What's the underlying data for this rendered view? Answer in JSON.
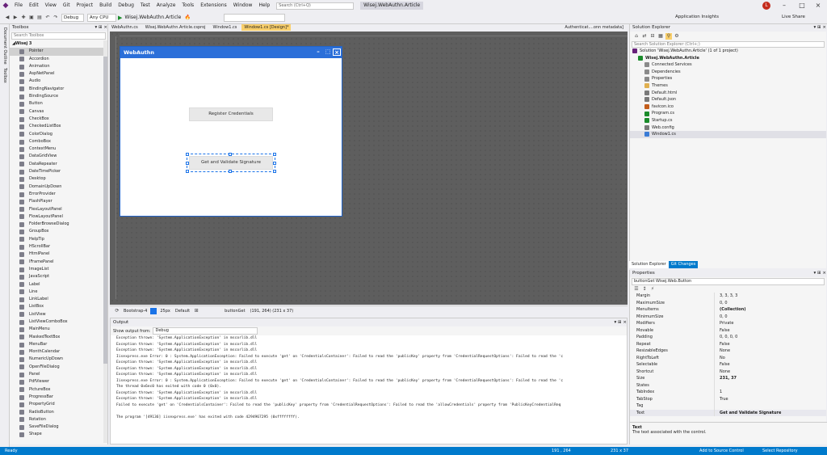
{
  "app": {
    "solution_name": "Wisej.WebAuthn.Article",
    "search_placeholder": "Search (Ctrl+Q)",
    "avatar": "L",
    "live_share": "Live Share",
    "app_insights": "Application Insights"
  },
  "menu": [
    "File",
    "Edit",
    "View",
    "Git",
    "Project",
    "Build",
    "Debug",
    "Test",
    "Analyze",
    "Tools",
    "Extensions",
    "Window",
    "Help"
  ],
  "toolbar": {
    "config": "Debug",
    "platform": "Any CPU",
    "start_target": "Wisej.WebAuthn.Article"
  },
  "left_strip": [
    "Document Outline",
    "Toolbox"
  ],
  "toolbox": {
    "title": "Toolbox",
    "search_placeholder": "Search Toolbox",
    "group": "Wisej 3",
    "items": [
      "Pointer",
      "Accordion",
      "Animation",
      "AspNetPanel",
      "Audio",
      "BindingNavigator",
      "BindingSource",
      "Button",
      "Canvas",
      "CheckBox",
      "CheckedListBox",
      "ColorDialog",
      "ComboBox",
      "ContextMenu",
      "DataGridView",
      "DataRepeater",
      "DateTimePicker",
      "Desktop",
      "DomainUpDown",
      "ErrorProvider",
      "FlashPlayer",
      "FlexLayoutPanel",
      "FlowLayoutPanel",
      "FolderBrowseDialog",
      "GroupBox",
      "HelpTip",
      "HScrollBar",
      "HtmlPanel",
      "IFramePanel",
      "ImageList",
      "JavaScript",
      "Label",
      "Line",
      "LinkLabel",
      "ListBox",
      "ListView",
      "ListViewComboBox",
      "MainMenu",
      "MaskedTextBox",
      "MenuBar",
      "MonthCalendar",
      "NumericUpDown",
      "OpenFileDialog",
      "Panel",
      "PdfViewer",
      "PictureBox",
      "ProgressBar",
      "PropertyGrid",
      "RadioButton",
      "Rotation",
      "SaveFileDialog",
      "Shape"
    ]
  },
  "doc_tabs": [
    "WebAuthn.cs",
    "Wisej.WebAuthn.Article.csproj",
    "Window1.cs",
    "Window1.cs [Design]*",
    "Authenticat....onn metadata]"
  ],
  "form": {
    "title": "WebAuthn",
    "button1": "Register Credentials",
    "button2": "Get and Validate Signature"
  },
  "design_bar": {
    "theme": "Bootstrap-4",
    "size": "25px",
    "layout": "Default",
    "selected": "buttonGet",
    "coords": "(191, 264) (231 x 37)"
  },
  "output": {
    "title": "Output",
    "show_from_label": "Show output from:",
    "show_from_value": "Debug",
    "lines": [
      "Exception thrown: 'System.ApplicationException' in mscorlib.dll",
      "Exception thrown: 'System.ApplicationException' in mscorlib.dll",
      "Exception thrown: 'System.ApplicationException' in mscorlib.dll",
      "Iisexpress.exe Error: 0 : System.ApplicationException: Failed to execute 'get' on 'CredentialsContainer': Failed to read the 'publicKey' property from 'CredentialRequestOptions': Failed to read the 'c",
      "Exception thrown: 'System.ApplicationException' in mscorlib.dll",
      "Exception thrown: 'System.ApplicationException' in mscorlib.dll",
      "Exception thrown: 'System.ApplicationException' in mscorlib.dll",
      "Iisexpress.exe Error: 0 : System.ApplicationException: Failed to execute 'get' on 'CredentialsContainer': Failed to read the 'publicKey' property from 'CredentialRequestOptions': Failed to read the 'c",
      "The thread 0x6ec0 has exited with code 0 (0x0).",
      "Exception thrown: 'System.ApplicationException' in mscorlib.dll",
      "Exception thrown: 'System.ApplicationException' in mscorlib.dll",
      "Failed to execute 'get' on 'CredentialsContainer': Failed to read the 'publicKey' property from 'CredentialRequestOptions': Failed to read the 'allowCredentials' property from 'PublicKeyCredentialReq",
      "",
      "The program '[49136] iisexpress.exe' has exited with code 4294967295 (0xffffffff)."
    ]
  },
  "solution_explorer": {
    "title": "Solution Explorer",
    "search_placeholder": "Search Solution Explorer (Ctrl+;)",
    "items": [
      "Solution 'Wisej.WebAuthn.Article' (1 of 1 project)",
      "Wisej.WebAuthn.Article",
      "Connected Services",
      "Dependencies",
      "Properties",
      "Themes",
      "Default.html",
      "Default.json",
      "favicon.ico",
      "Program.cs",
      "Startup.cs",
      "Web.config",
      "Window1.cs"
    ],
    "tabs": [
      "Solution Explorer",
      "Git Changes"
    ]
  },
  "properties": {
    "title": "Properties",
    "selected_object": "buttonGet  Wisej.Web.Button",
    "rows": [
      [
        "Margin",
        "3, 3, 3, 3"
      ],
      [
        "MaximumSize",
        "0, 0"
      ],
      [
        "MenuItems",
        "(Collection)"
      ],
      [
        "MinimumSize",
        "0, 0"
      ],
      [
        "Modifiers",
        "Private"
      ],
      [
        "Movable",
        "False"
      ],
      [
        "Padding",
        "0, 0, 0, 0"
      ],
      [
        "Repeat",
        "False"
      ],
      [
        "ResizableEdges",
        "None"
      ],
      [
        "RightToLeft",
        "No"
      ],
      [
        "Selectable",
        "False"
      ],
      [
        "Shortcut",
        "None"
      ],
      [
        "Size",
        "231, 37"
      ],
      [
        "States",
        ""
      ],
      [
        "TabIndex",
        "1"
      ],
      [
        "TabStop",
        "True"
      ],
      [
        "Tag",
        ""
      ],
      [
        "Text",
        "Get and Validate Signature"
      ]
    ],
    "desc_title": "Text",
    "desc_text": "The text associated with the control."
  },
  "status": {
    "ready": "Ready",
    "pos": "191 , 264",
    "size": "231 x 37",
    "source_control": "Add to Source Control",
    "repo": "Select Repository"
  }
}
